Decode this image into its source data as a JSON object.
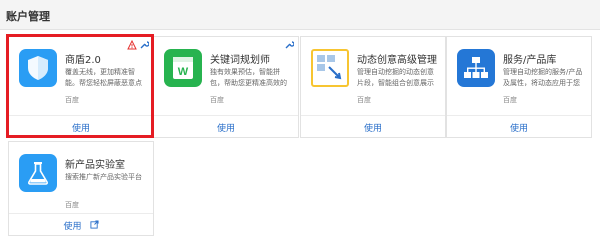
{
  "header": {
    "title": "账户管理"
  },
  "cards": [
    {
      "title": "商盾2.0",
      "desc": "覆盖无线，更加精准智能。帮您轻松屏蔽恶意点击，提升转化。",
      "vendor": "百度",
      "action": "使用",
      "logo_icon": "shield-icon",
      "logo_color": "#2a9df4"
    },
    {
      "title": "关键词规划师",
      "desc": "独有效果预估，智能拼包，帮助您更精准高效的推广。",
      "vendor": "百度",
      "action": "使用",
      "logo_icon": "word-doc-icon",
      "logo_color": "#27b34f"
    },
    {
      "title": "动态创意高级管理",
      "desc": "管理自动挖掘的动态创意片段，智能组合创意展示给搜索用户。",
      "vendor": "百度",
      "action": "使用",
      "logo_icon": "dynamic-creative-icon",
      "logo_color": "#f7c531"
    },
    {
      "title": "服务/产品库",
      "desc": "管理自动挖掘的服务/产品及属性，将动态应用于您的创意。",
      "vendor": "百度",
      "action": "使用",
      "logo_icon": "hierarchy-icon",
      "logo_color": "#2477d6"
    },
    {
      "title": "新产品实验室",
      "desc": "搜索推广新产品实验平台",
      "vendor": "百度",
      "action": "使用",
      "logo_icon": "flask-icon",
      "logo_color": "#2a9df4"
    }
  ]
}
